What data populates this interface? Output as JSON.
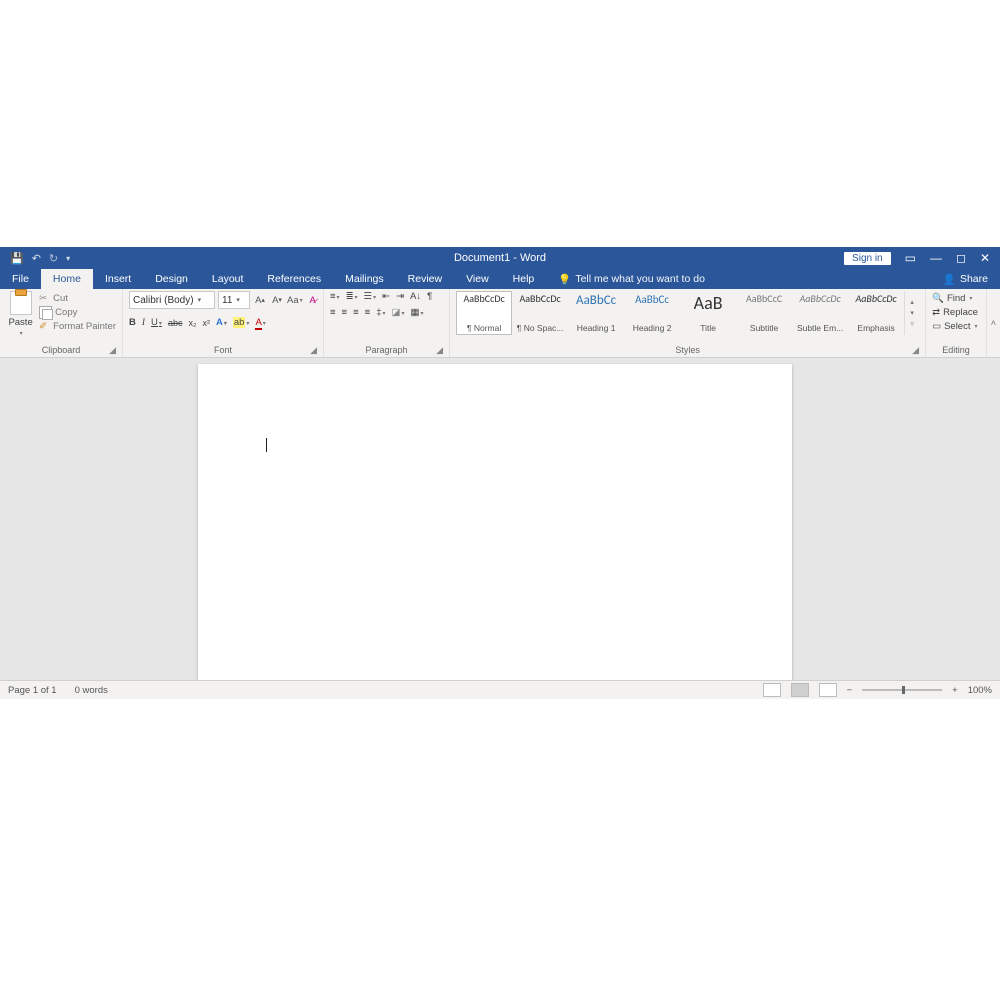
{
  "titlebar": {
    "title": "Document1 - Word",
    "signin": "Sign in"
  },
  "tabs": {
    "file": "File",
    "home": "Home",
    "insert": "Insert",
    "design": "Design",
    "layout": "Layout",
    "references": "References",
    "mailings": "Mailings",
    "review": "Review",
    "view": "View",
    "help": "Help",
    "tellme": "Tell me what you want to do",
    "share": "Share"
  },
  "clipboard": {
    "paste": "Paste",
    "cut": "Cut",
    "copy": "Copy",
    "format_painter": "Format Painter",
    "label": "Clipboard"
  },
  "font": {
    "name": "Calibri (Body)",
    "size": "11",
    "label": "Font"
  },
  "paragraph": {
    "label": "Paragraph"
  },
  "styles": {
    "label": "Styles",
    "items": [
      {
        "preview": "AaBbCcDc",
        "name": "¶ Normal"
      },
      {
        "preview": "AaBbCcDc",
        "name": "¶ No Spac..."
      },
      {
        "preview": "AaBbCc",
        "name": "Heading 1"
      },
      {
        "preview": "AaBbCc",
        "name": "Heading 2"
      },
      {
        "preview": "AaB",
        "name": "Title"
      },
      {
        "preview": "AaBbCcC",
        "name": "Subtitle"
      },
      {
        "preview": "AaBbCcDc",
        "name": "Subtle Em..."
      },
      {
        "preview": "AaBbCcDc",
        "name": "Emphasis"
      }
    ]
  },
  "editing": {
    "find": "Find",
    "replace": "Replace",
    "select": "Select",
    "label": "Editing"
  },
  "status": {
    "page": "Page 1 of 1",
    "words": "0 words",
    "zoom": "100%"
  }
}
